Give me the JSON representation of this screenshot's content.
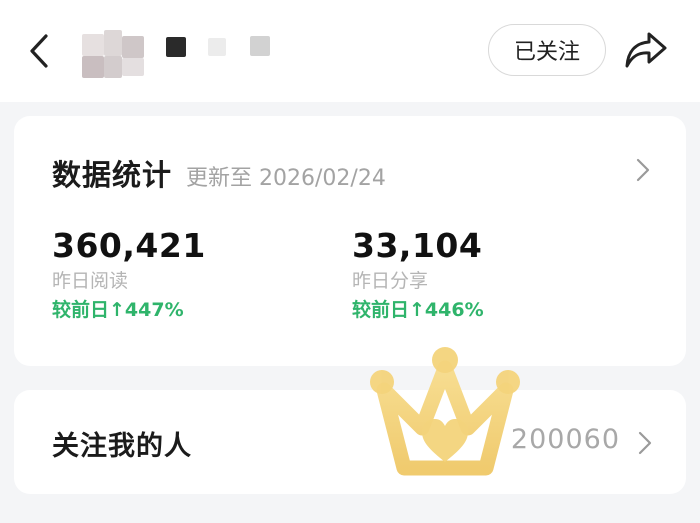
{
  "header": {
    "follow_label": "已关注"
  },
  "stats": {
    "title": "数据统计",
    "updated": "更新至 2026/02/24",
    "metrics": [
      {
        "value": "360,421",
        "label": "昨日阅读",
        "delta": "较前日↑447%"
      },
      {
        "value": "33,104",
        "label": "昨日分享",
        "delta": "较前日↑446%"
      }
    ]
  },
  "followers": {
    "label": "关注我的人",
    "count": "200060"
  },
  "colors": {
    "accent_green": "#2fb46b",
    "muted_text": "#a3a3a3",
    "crown_yellow": "#f3d27a"
  },
  "icons": {
    "back": "chevron-left-icon",
    "share": "share-arrow-icon",
    "chevron": "chevron-right-icon",
    "crown": "crown-sticker-icon"
  }
}
